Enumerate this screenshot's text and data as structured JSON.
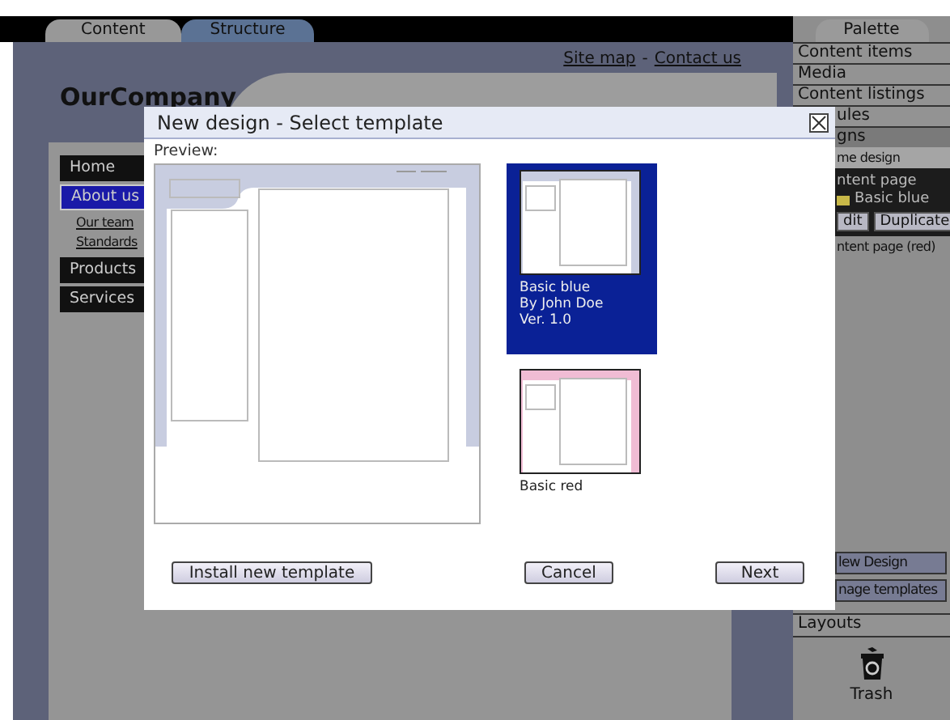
{
  "tabs": [
    {
      "label": "Content",
      "selected": true
    },
    {
      "label": "Structure",
      "selected": false
    }
  ],
  "site": {
    "links": [
      "Site map",
      "Contact us"
    ],
    "link_separator": "-",
    "company": "OurCompany",
    "nav": [
      {
        "label": "Home",
        "kind": "item",
        "selected": false
      },
      {
        "label": "About us",
        "kind": "item",
        "selected": true
      },
      {
        "label": "Our team",
        "kind": "subitem",
        "selected": false
      },
      {
        "label": "Standards",
        "kind": "subitem",
        "selected": false
      },
      {
        "label": "Products",
        "kind": "item",
        "selected": false
      },
      {
        "label": "Services",
        "kind": "item",
        "selected": false
      }
    ]
  },
  "palette": {
    "title": "Palette",
    "sections": [
      "Content items",
      "Media",
      "Content listings",
      "ules"
    ],
    "designs": {
      "header": "gns",
      "home_design": "me design",
      "current": {
        "page": "ntent page",
        "template": "Basic blue",
        "buttons": [
          "dit",
          "Duplicate"
        ]
      },
      "other": "ntent page (red)",
      "actions": [
        "lew Design",
        "nage templates"
      ]
    },
    "layouts": "Layouts",
    "trash": "Trash"
  },
  "dialog": {
    "title": "New design - Select template",
    "preview_label": "Preview:",
    "templates": [
      {
        "name": "Basic blue",
        "author": "By John Doe",
        "version": "Ver. 1.0",
        "selected": true,
        "color": "#c8cde0"
      },
      {
        "name": "Basic red",
        "selected": false,
        "color": "#f0bcd4"
      }
    ],
    "buttons": [
      "Install new template",
      "Cancel",
      "Next"
    ]
  }
}
